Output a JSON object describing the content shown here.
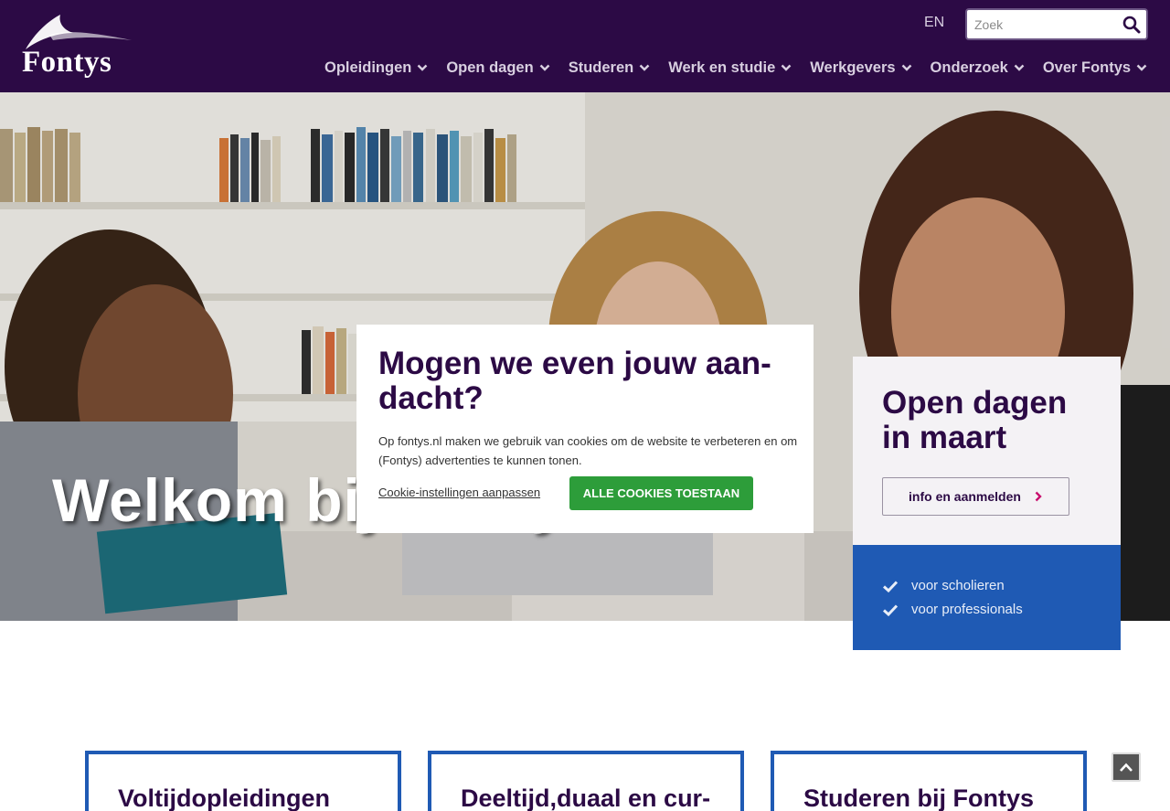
{
  "header": {
    "logo_text": "Fontys",
    "lang_switch": "EN",
    "search": {
      "placeholder": "Zoek"
    },
    "nav": [
      {
        "label": "Opleidingen"
      },
      {
        "label": "Open dagen"
      },
      {
        "label": "Studeren"
      },
      {
        "label": "Werk en studie"
      },
      {
        "label": "Werkgevers"
      },
      {
        "label": "Onderzoek"
      },
      {
        "label": "Over Fontys"
      }
    ]
  },
  "hero": {
    "title": "Welkom bij Fontys"
  },
  "open_dagen": {
    "title": "Open dagen in maart",
    "button_label": "info en aanmelden",
    "links": [
      {
        "label": "voor scholieren"
      },
      {
        "label": "voor professionals"
      }
    ]
  },
  "cookie_dialog": {
    "title": "Mogen we even jouw aan-dacht?",
    "text": "Op fontys.nl maken we gebruik van cookies om de website te verbeteren en om (Fontys) advertenties te kunnen tonen.",
    "settings_link": "Cookie-instellingen aanpassen",
    "accept_button": "ALLE COOKIES TOESTAAN"
  },
  "cards": [
    {
      "title": "Voltijdopleidingen"
    },
    {
      "title": "Deeltijd,duaal en cur-"
    },
    {
      "title": "Studeren bij Fontys"
    }
  ],
  "colors": {
    "header_bg": "#2c0a45",
    "accent_blue": "#1f5ab4",
    "accept_green": "#2d9d3a",
    "title_purple": "#2c0a45"
  },
  "icons": {
    "search": "search-icon",
    "chevron": "chevron-down-icon",
    "arrow": "chevron-right-icon",
    "check": "check-icon",
    "back_to_top": "chevron-up-icon"
  }
}
